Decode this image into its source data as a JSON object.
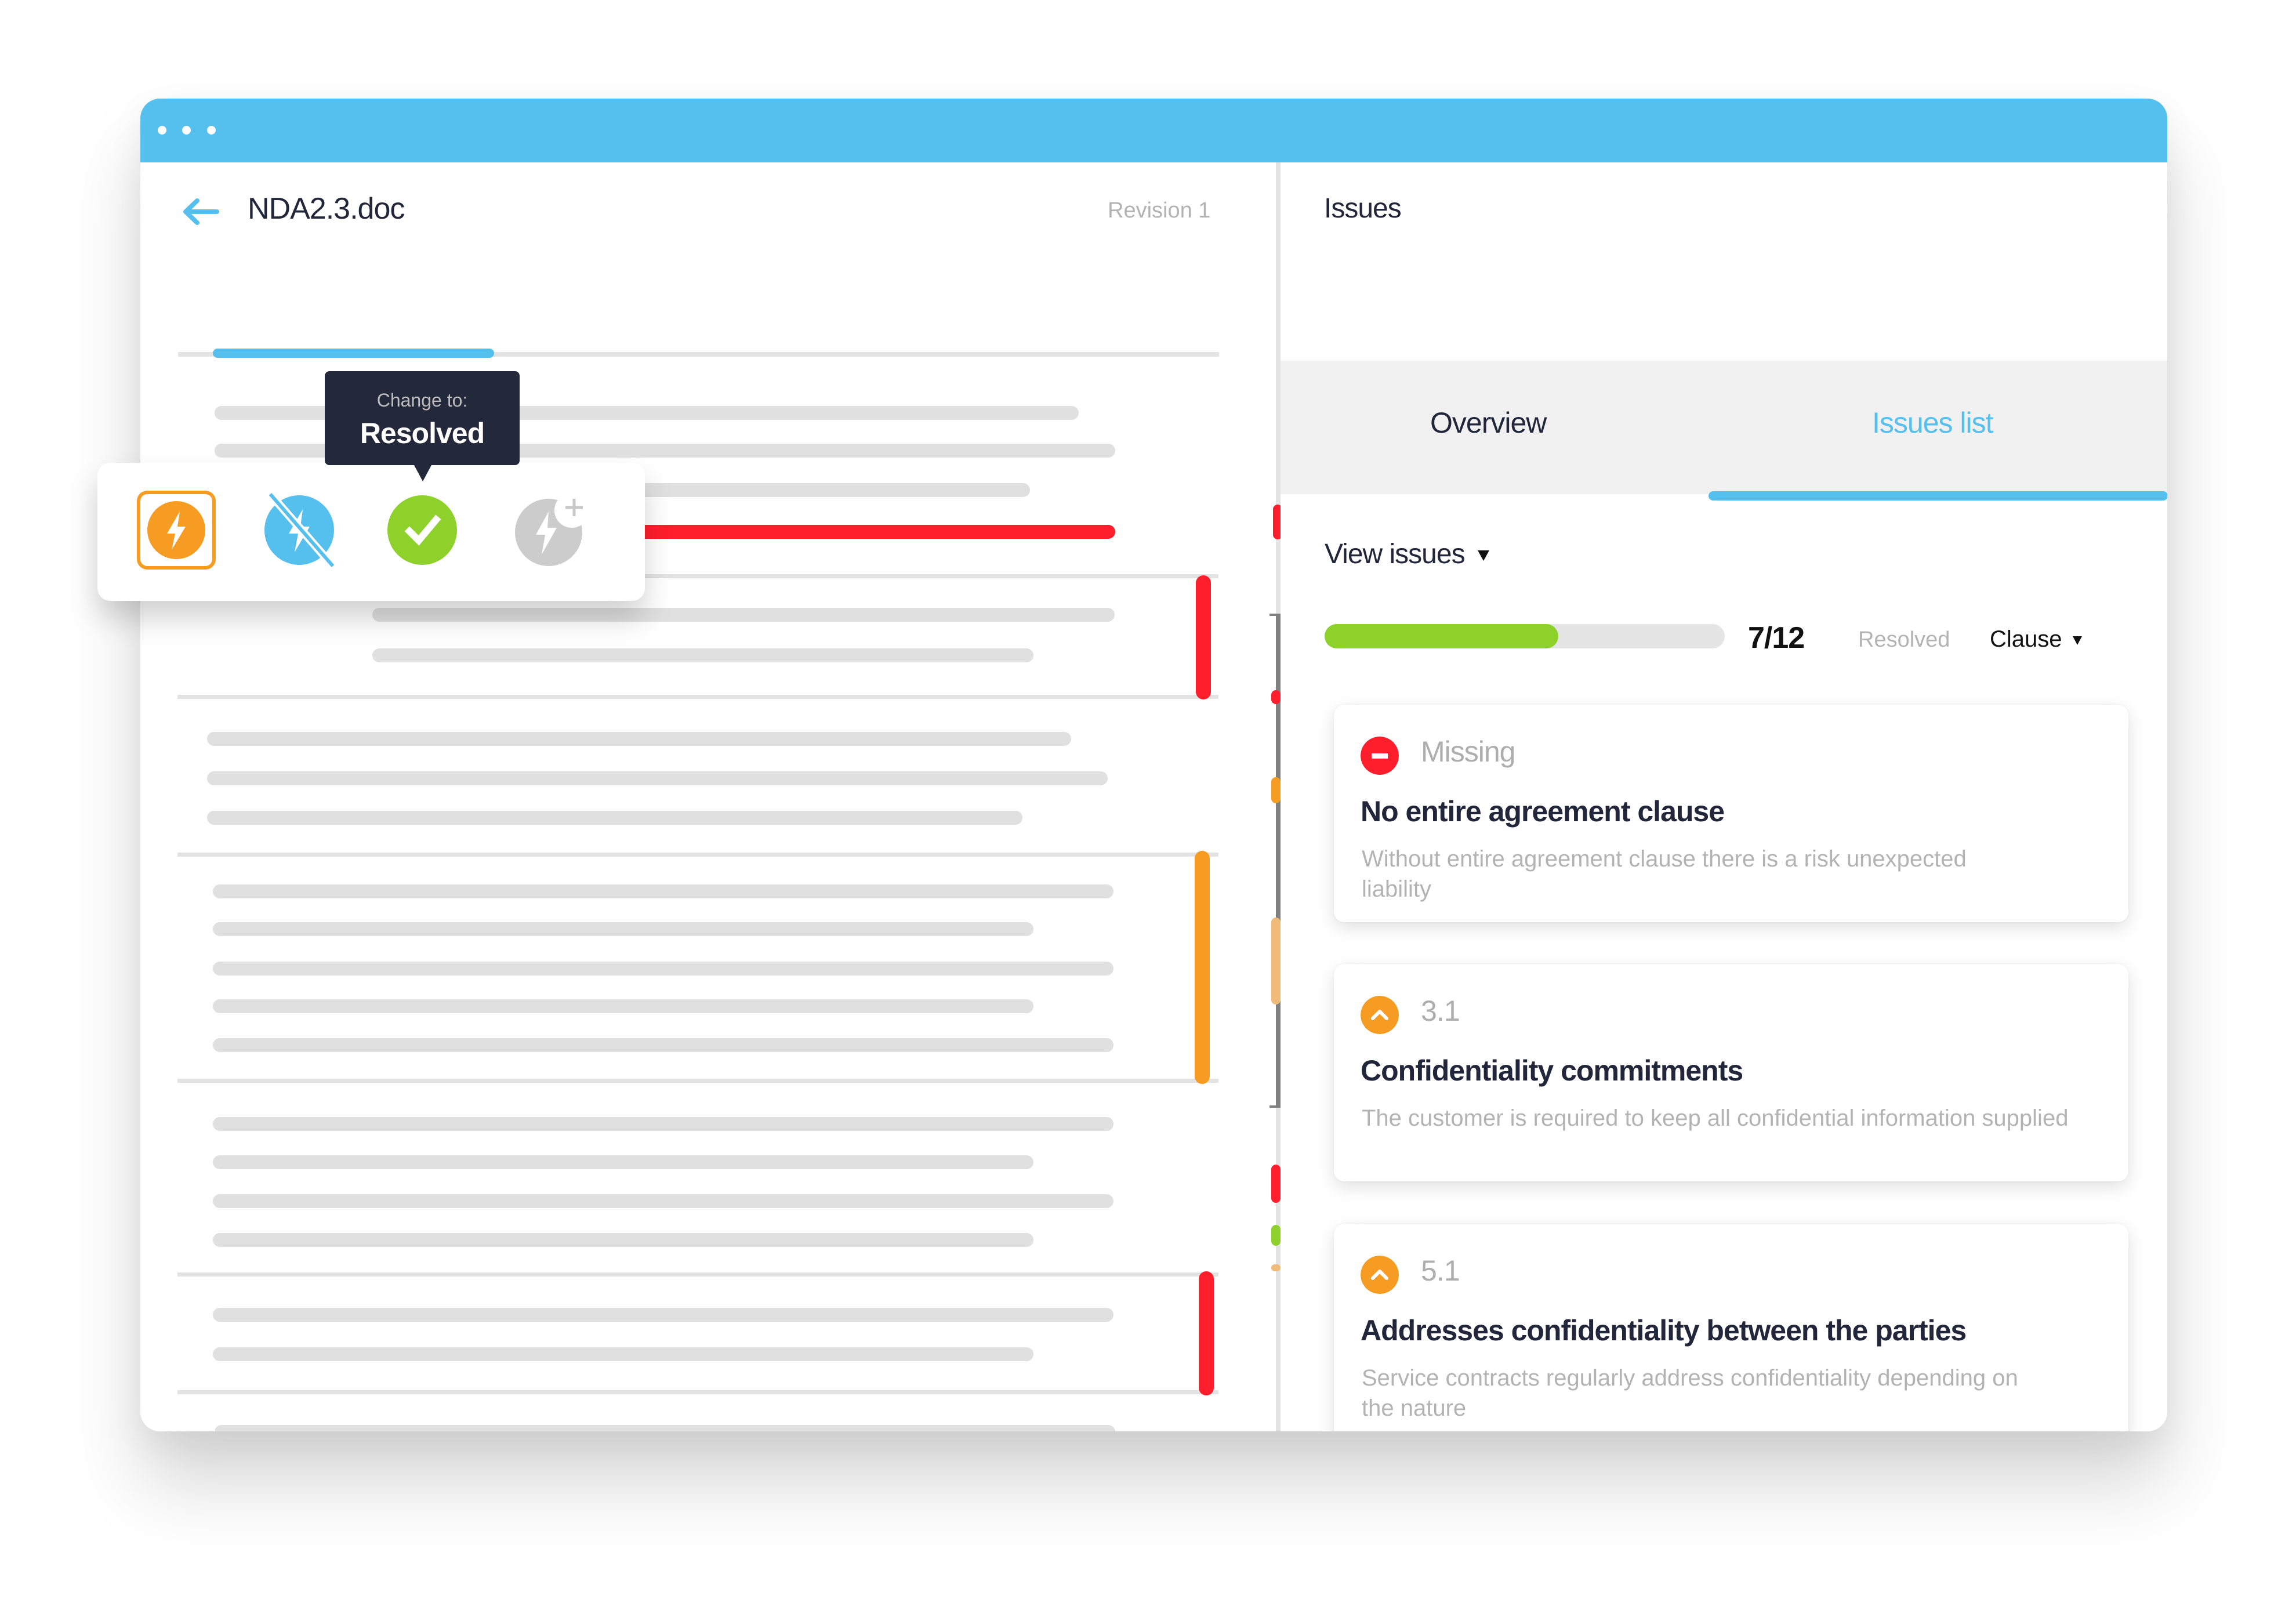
{
  "window": {
    "titlebar_dots": 3,
    "accent_color": "#55BFED"
  },
  "document": {
    "back_icon": "arrow-left-icon",
    "title": "NDA2.3.doc",
    "revision": "Revision 1"
  },
  "status_popup": {
    "tooltip_label": "Change to:",
    "tooltip_value": "Resolved",
    "options": [
      {
        "name": "open-issue",
        "icon": "lightning-icon",
        "color": "#F69C22",
        "selected": true
      },
      {
        "name": "dismissed",
        "icon": "lightning-off-icon",
        "color": "#55BFED",
        "selected": false
      },
      {
        "name": "resolved",
        "icon": "checkmark-icon",
        "color": "#8ED12A",
        "selected": false
      },
      {
        "name": "add-issue",
        "icon": "lightning-plus-icon",
        "color": "#cccccc",
        "selected": false
      }
    ]
  },
  "issues_panel": {
    "title": "Issues",
    "tabs": [
      {
        "label": "Overview",
        "active": false
      },
      {
        "label": "Issues list",
        "active": true
      }
    ],
    "view_issues_label": "View issues",
    "progress": {
      "resolved": 7,
      "total": 12,
      "count_text": "7/12",
      "label": "Resolved"
    },
    "sort_filter": "Clause",
    "cards": [
      {
        "severity": "missing",
        "icon": "minus-circle-icon",
        "icon_color": "#FF1E2B",
        "tag": "Missing",
        "title": "No entire agreement clause",
        "description": "Without entire agreement clause there is a risk unexpected liability"
      },
      {
        "severity": "warning",
        "icon": "chevron-up-circle-icon",
        "icon_color": "#F69C22",
        "tag": "3.1",
        "title": "Confidentiality commitments",
        "description": "The customer is required to keep all confidential information supplied"
      },
      {
        "severity": "warning",
        "icon": "chevron-up-circle-icon",
        "icon_color": "#F69C22",
        "tag": "5.1",
        "title": "Addresses confidentiality between the parties",
        "description": "Service contracts regularly address confidentiality depending on the nature"
      }
    ]
  },
  "colors": {
    "red": "#FF1E2B",
    "orange": "#F69C22",
    "light_orange": "#F0BB79",
    "green": "#8ED12A",
    "blue": "#55BFED",
    "dark": "#22263a"
  }
}
